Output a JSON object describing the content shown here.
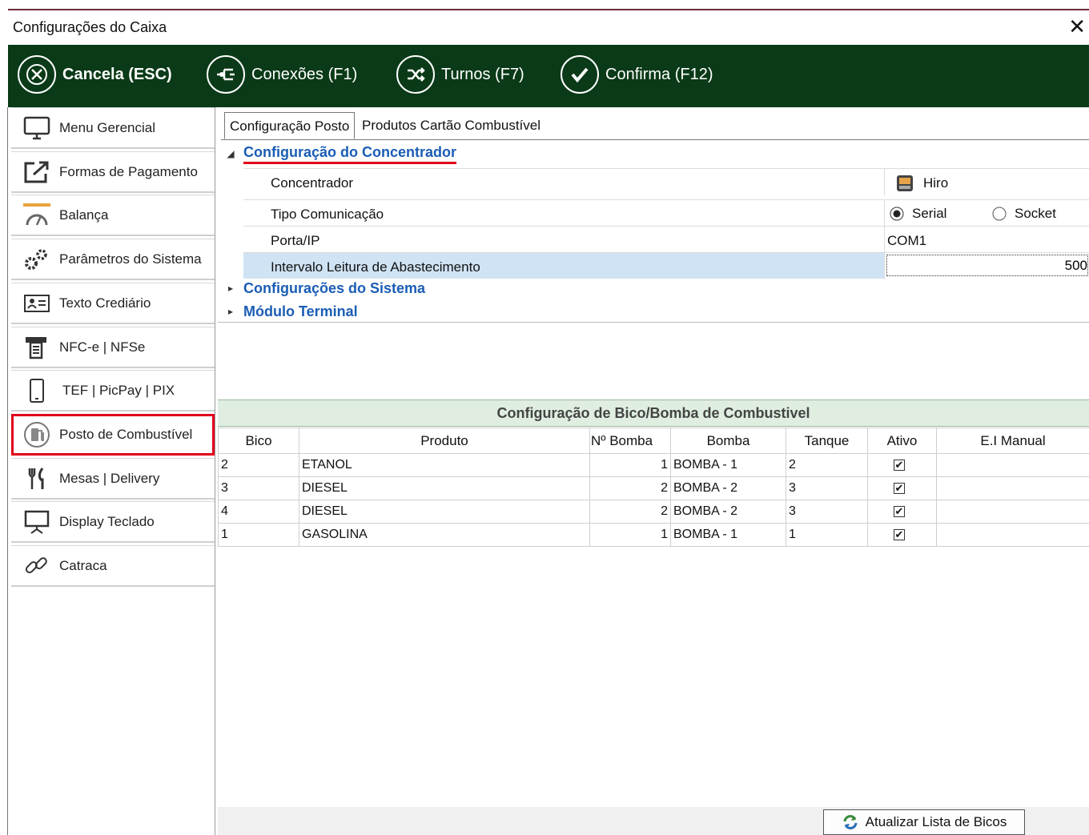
{
  "window": {
    "title": "Configurações do Caixa",
    "close_glyph": "✕"
  },
  "toolbar": [
    {
      "label": "Cancela (ESC)",
      "icon": "cancel-icon",
      "bold": true
    },
    {
      "label": "Conexões (F1)",
      "icon": "connections-icon",
      "bold": false
    },
    {
      "label": "Turnos (F7)",
      "icon": "shuffle-icon",
      "bold": false
    },
    {
      "label": "Confirma (F12)",
      "icon": "confirm-check-icon",
      "bold": false
    }
  ],
  "sidebar": [
    {
      "label": "Menu Gerencial",
      "icon": "monitor-icon"
    },
    {
      "label": "Formas de Pagamento",
      "icon": "external-link-icon"
    },
    {
      "label": "Balança",
      "icon": "scale-gauge-icon"
    },
    {
      "label": "Parâmetros do Sistema",
      "icon": "gears-icon"
    },
    {
      "label": "Texto Crediário",
      "icon": "id-card-icon"
    },
    {
      "label": "NFC-e | NFSe",
      "icon": "receipt-printer-icon"
    },
    {
      "label": "TEF | PicPay | PIX",
      "icon": "smartphone-icon"
    },
    {
      "label": "Posto de Combustível",
      "icon": "fuel-pump-icon",
      "selected": true
    },
    {
      "label": "Mesas | Delivery",
      "icon": "fork-knife-icon"
    },
    {
      "label": "Display Teclado",
      "icon": "display-icon"
    },
    {
      "label": "Catraca",
      "icon": "link-icon"
    }
  ],
  "tabs": [
    {
      "label": "Configuração Posto",
      "active": true
    },
    {
      "label": "Produtos Cartão Combustível",
      "active": false
    }
  ],
  "property_grid": {
    "section_open": "Configuração do Concentrador",
    "rows": {
      "concentrador": {
        "name": "Concentrador",
        "value": "Hiro"
      },
      "tipo": {
        "name": "Tipo Comunicação",
        "option_a": "Serial",
        "option_b": "Socket",
        "selected": "Serial"
      },
      "porta": {
        "name": "Porta/IP",
        "value": "COM1"
      },
      "intervalo": {
        "name": "Intervalo Leitura de Abastecimento",
        "value": "500"
      }
    },
    "section_2": "Configurações do Sistema",
    "section_3": "Módulo Terminal"
  },
  "grid": {
    "title": "Configuração de Bico/Bomba de Combustivel",
    "headers": [
      "Bico",
      "Produto",
      "Nº Bomba",
      "Bomba",
      "Tanque",
      "Ativo",
      "E.I Manual"
    ],
    "rows": [
      [
        "2",
        "ETANOL",
        "1",
        "BOMBA - 1",
        "2",
        true,
        ""
      ],
      [
        "3",
        "DIESEL",
        "2",
        "BOMBA - 2",
        "3",
        true,
        ""
      ],
      [
        "4",
        "DIESEL",
        "2",
        "BOMBA - 2",
        "3",
        true,
        ""
      ],
      [
        "1",
        "GASOLINA",
        "1",
        "BOMBA - 1",
        "1",
        true,
        ""
      ]
    ]
  },
  "footer": {
    "refresh_button": "Atualizar Lista de Bicos"
  },
  "colors": {
    "toolbar_bg": "#0a3a17",
    "link_blue": "#1a5db5",
    "highlight_red": "#e0001a",
    "selected_row": "#cfe3f4"
  }
}
